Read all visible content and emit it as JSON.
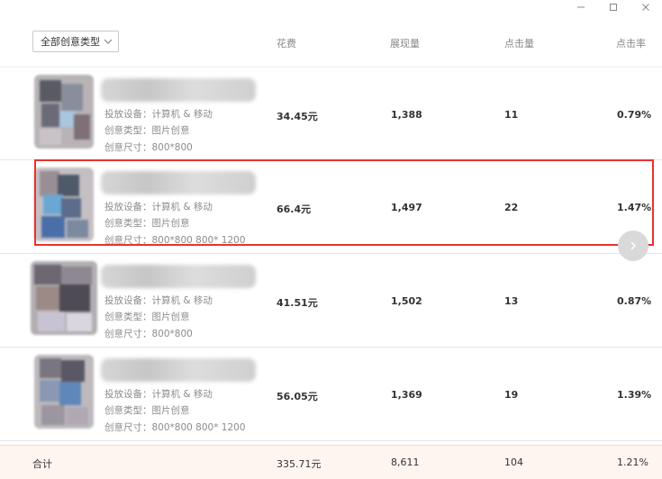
{
  "window": {
    "icons": [
      "minimize-icon",
      "maximize-icon",
      "close-icon"
    ]
  },
  "filter": {
    "selected": "全部创意类型"
  },
  "columns": {
    "cost": "花费",
    "impressions": "展现量",
    "clicks": "点击量",
    "ctr": "点击率"
  },
  "rows": [
    {
      "device": "投放设备：计算机 & 移动",
      "type": "创意类型：图片创意",
      "size": "创意尺寸：800*800",
      "cost": "34.45元",
      "impressions": "1,388",
      "clicks": "11",
      "ctr": "0.79%"
    },
    {
      "device": "投放设备：计算机 & 移动",
      "type": "创意类型：图片创意",
      "size": "创意尺寸：800*800 800* 1200",
      "cost": "66.4元",
      "impressions": "1,497",
      "clicks": "22",
      "ctr": "1.47%"
    },
    {
      "device": "投放设备：计算机 & 移动",
      "type": "创意类型：图片创意",
      "size": "创意尺寸：800*800",
      "cost": "41.51元",
      "impressions": "1,502",
      "clicks": "13",
      "ctr": "0.87%"
    },
    {
      "device": "投放设备：计算机 & 移动",
      "type": "创意类型：图片创意",
      "size": "创意尺寸：800*800 800* 1200",
      "cost": "56.05元",
      "impressions": "1,369",
      "clicks": "19",
      "ctr": "1.39%"
    }
  ],
  "total": {
    "label": "合计",
    "cost": "335.71元",
    "impressions": "8,611",
    "clicks": "104",
    "ctr": "1.21%"
  },
  "colors": {
    "highlight": "#e8322e",
    "total_bg": "#fff5ef",
    "header_text": "#888888"
  }
}
